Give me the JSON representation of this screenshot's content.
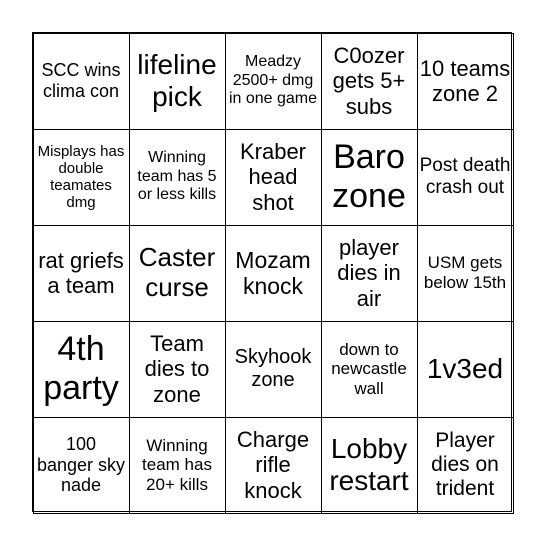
{
  "card": {
    "cells": [
      "SCC wins clima con",
      "lifeline pick",
      "Meadzy 2500+ dmg in one game",
      "C0ozer gets 5+ subs",
      "10 teams zone 2",
      "Misplays has double teamates dmg",
      "Winning team has 5 or less kills",
      "Kraber head shot",
      "Baro zone",
      "Post death crash out",
      "rat griefs a team",
      "Caster curse",
      "Mozam knock",
      "player dies in air",
      "USM gets below 15th",
      "4th party",
      "Team dies to zone",
      "Skyhook zone",
      "down to newcastle wall",
      "1v3ed",
      "100 banger sky nade",
      "Winning team has 20+ kills",
      "Charge rifle knock",
      "Lobby restart",
      "Player dies on trident"
    ]
  }
}
